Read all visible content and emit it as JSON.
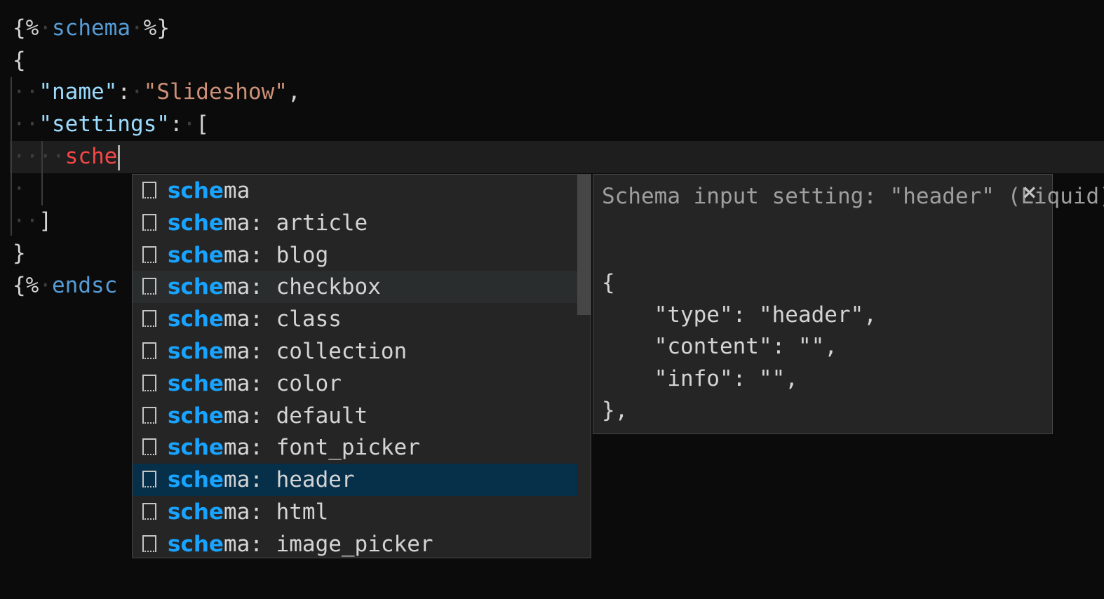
{
  "editor": {
    "line1": {
      "open": "{%",
      "keyword": "schema",
      "close": "%}"
    },
    "line2": "{",
    "line3": {
      "key": "\"name\"",
      "colon": ":",
      "value": "\"Slideshow\"",
      "comma": ","
    },
    "line4": {
      "key": "\"settings\"",
      "colon": ":",
      "bracket": "["
    },
    "line5": {
      "typed": "sche"
    },
    "line7": "]",
    "line8": "}",
    "line9": {
      "open": "{%",
      "keyword": "endsc"
    }
  },
  "suggest": {
    "match": "sche",
    "items": [
      {
        "rest": "ma"
      },
      {
        "rest": "ma: article"
      },
      {
        "rest": "ma: blog"
      },
      {
        "rest": "ma: checkbox"
      },
      {
        "rest": "ma: class"
      },
      {
        "rest": "ma: collection"
      },
      {
        "rest": "ma: color"
      },
      {
        "rest": "ma: default"
      },
      {
        "rest": "ma: font_picker"
      },
      {
        "rest": "ma: header"
      },
      {
        "rest": "ma: html"
      },
      {
        "rest": "ma: image_picker"
      }
    ],
    "selected_index": 9,
    "hover_index": 3
  },
  "details": {
    "title": "Schema input setting: \"header\" (Liquid)",
    "close_icon": "×",
    "code": "{\n    \"type\": \"header\",\n    \"content\": \"\",\n    \"info\": \"\",\n},"
  },
  "colors": {
    "background": "#0b0b0b",
    "highlight": "#18a3ff",
    "selected": "#062f4a",
    "string": "#ce9178",
    "key": "#9cdcfe",
    "keyword": "#569cd6",
    "error": "#f44747"
  }
}
